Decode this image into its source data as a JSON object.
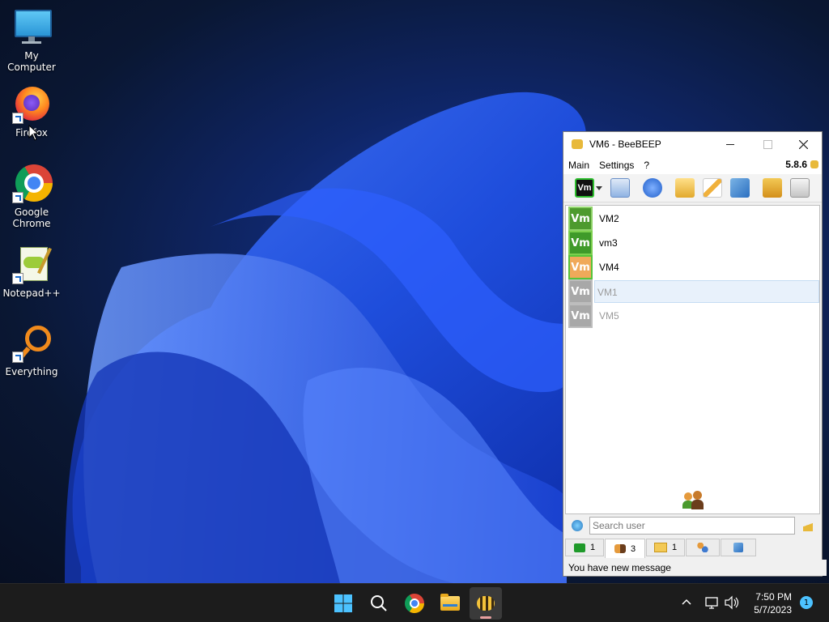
{
  "desktop": {
    "icons": [
      {
        "label": "My Computer"
      },
      {
        "label": "Firefox"
      },
      {
        "label": "Google Chrome"
      },
      {
        "label": "Notepad++"
      },
      {
        "label": "Everything"
      }
    ]
  },
  "window": {
    "title": "VM6 - BeeBEEP",
    "menu": [
      "Main",
      "Settings",
      "?"
    ],
    "version": "5.8.6",
    "toolbar_avatar": "Vm",
    "users": [
      {
        "name": "VM2",
        "avatar": "Vm",
        "color": "#4d9a2e",
        "online": true
      },
      {
        "name": "vm3",
        "avatar": "Vm",
        "color": "#3f9a2a",
        "online": true
      },
      {
        "name": "VM4",
        "avatar": "Vm",
        "color": "#f0a95a",
        "online": true
      },
      {
        "name": "VM1",
        "avatar": "Vm",
        "color": "#a8a8a8",
        "online": false
      },
      {
        "name": "VM5",
        "avatar": "Vm",
        "color": "#a8a8a8",
        "online": false
      }
    ],
    "search_placeholder": "Search user",
    "tabs": [
      {
        "count": "1"
      },
      {
        "count": "3"
      },
      {
        "count": "1"
      },
      {
        "count": ""
      },
      {
        "count": ""
      }
    ],
    "status": "You have new message"
  },
  "taskbar": {
    "time": "7:50 PM",
    "date": "5/7/2023",
    "notification_count": "1"
  }
}
